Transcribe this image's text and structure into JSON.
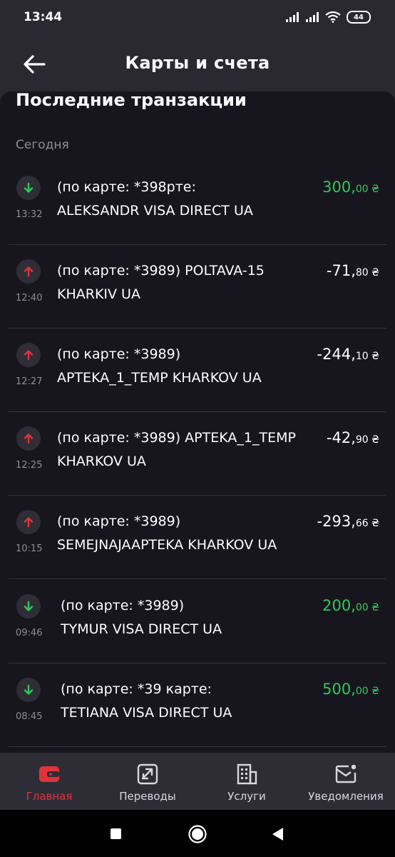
{
  "status": {
    "time": "13:44",
    "battery": "44"
  },
  "header": {
    "title": "Карты и счета"
  },
  "section": {
    "title": "Последние транзакции",
    "date": "Сегодня"
  },
  "transactions": [
    {
      "direction": "in",
      "time": "13:32",
      "line1": "(по карте: *398рте:",
      "line2": "ALEKSANDR VISA DIRECT UA",
      "amount_main": "300,",
      "amount_cents": "00 ₴"
    },
    {
      "direction": "out",
      "time": "12:40",
      "line1": "(по карте: *3989) POLTAVA-15",
      "line2": "KHARKIV UA",
      "amount_main": "-71,",
      "amount_cents": "80 ₴"
    },
    {
      "direction": "out",
      "time": "12:27",
      "line1": "(по карте: *3989)",
      "line2": "APTEKA_1_TEMP KHARKOV UA",
      "amount_main": "-244,",
      "amount_cents": "10 ₴"
    },
    {
      "direction": "out",
      "time": "12:25",
      "line1": "(по карте: *3989) APTEKA_1_TEMP",
      "line2": "KHARKOV UA",
      "amount_main": "-42,",
      "amount_cents": "90 ₴"
    },
    {
      "direction": "out",
      "time": "10:15",
      "line1": "(по карте: *3989)",
      "line2": "SEMEJNAJAAPTEKA KHARKOV UA",
      "amount_main": "-293,",
      "amount_cents": "66 ₴"
    },
    {
      "direction": "in",
      "time": "09:46",
      "line1": "(по карте: *3989)",
      "line2": "TYMUR VISA DIRECT UA",
      "amount_main": "200,",
      "amount_cents": "00 ₴"
    },
    {
      "direction": "in",
      "time": "08:45",
      "line1": "(по карте: *39 карте:",
      "line2": "TETIANA VISA DIRECT UA",
      "amount_main": "500,",
      "amount_cents": "00 ₴"
    }
  ],
  "nav": {
    "home": "Главная",
    "transfers": "Переводы",
    "services": "Услуги",
    "notifications": "Уведомления"
  },
  "colors": {
    "accent": "#e0333a",
    "income": "#34c759",
    "expense": "#e0333a"
  }
}
